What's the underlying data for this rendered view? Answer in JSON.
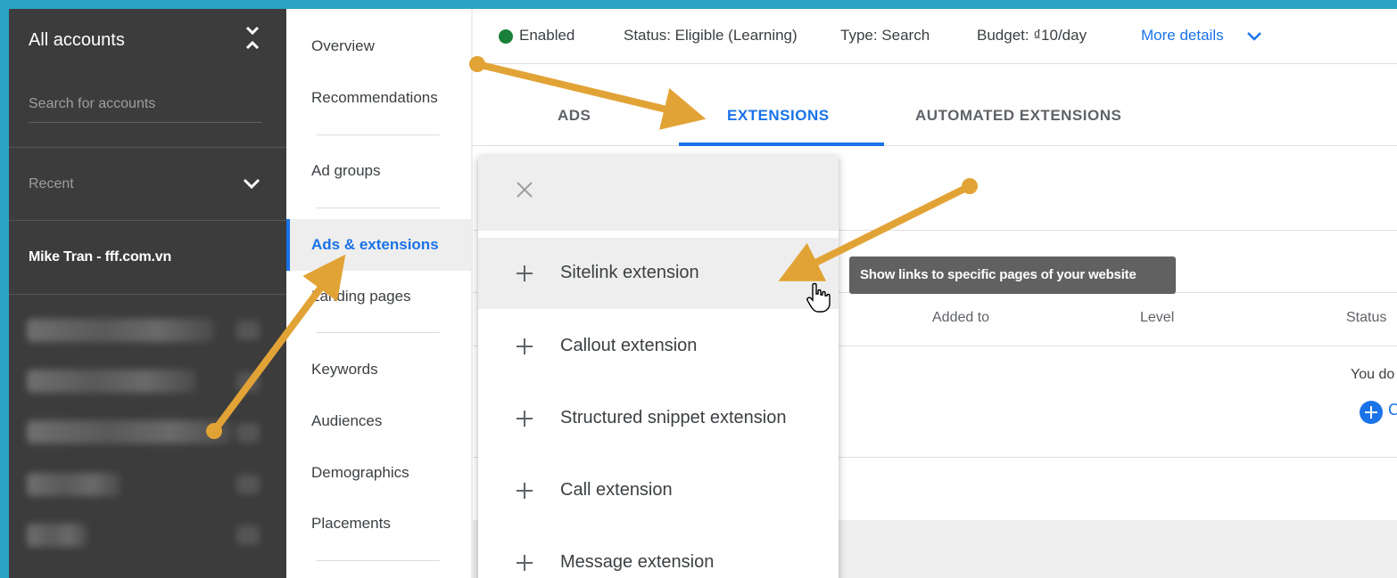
{
  "account_sidebar": {
    "title": "All accounts",
    "search_placeholder": "Search for accounts",
    "recent_label": "Recent",
    "current_account": "Mike Tran - fff.com.vn"
  },
  "nav": {
    "items": [
      "Overview",
      "Recommendations",
      "Ad groups",
      "Ads & extensions",
      "Landing pages",
      "Keywords",
      "Audiences",
      "Demographics",
      "Placements"
    ],
    "active": "Ads & extensions"
  },
  "topbar": {
    "status": "Enabled",
    "status_color": "#188038",
    "eligibility": "Status: Eligible (Learning)",
    "type": "Type: Search",
    "budget": "Budget: ₫10/day",
    "more_details": "More details"
  },
  "tabs": {
    "items": [
      "ADS",
      "EXTENSIONS",
      "AUTOMATED EXTENSIONS"
    ],
    "active": "EXTENSIONS"
  },
  "table": {
    "columns": [
      "Added to",
      "Level",
      "Status"
    ],
    "empty_text": "You do",
    "add_label": "C"
  },
  "menu": {
    "items": [
      "Sitelink extension",
      "Callout extension",
      "Structured snippet extension",
      "Call extension",
      "Message extension"
    ],
    "hovered": "Sitelink extension"
  },
  "tooltip": "Show links to specific pages of your website",
  "colors": {
    "accent": "#1a73e8",
    "annotation_arrow": "#e2a336",
    "frame": "#2aa3c5"
  }
}
